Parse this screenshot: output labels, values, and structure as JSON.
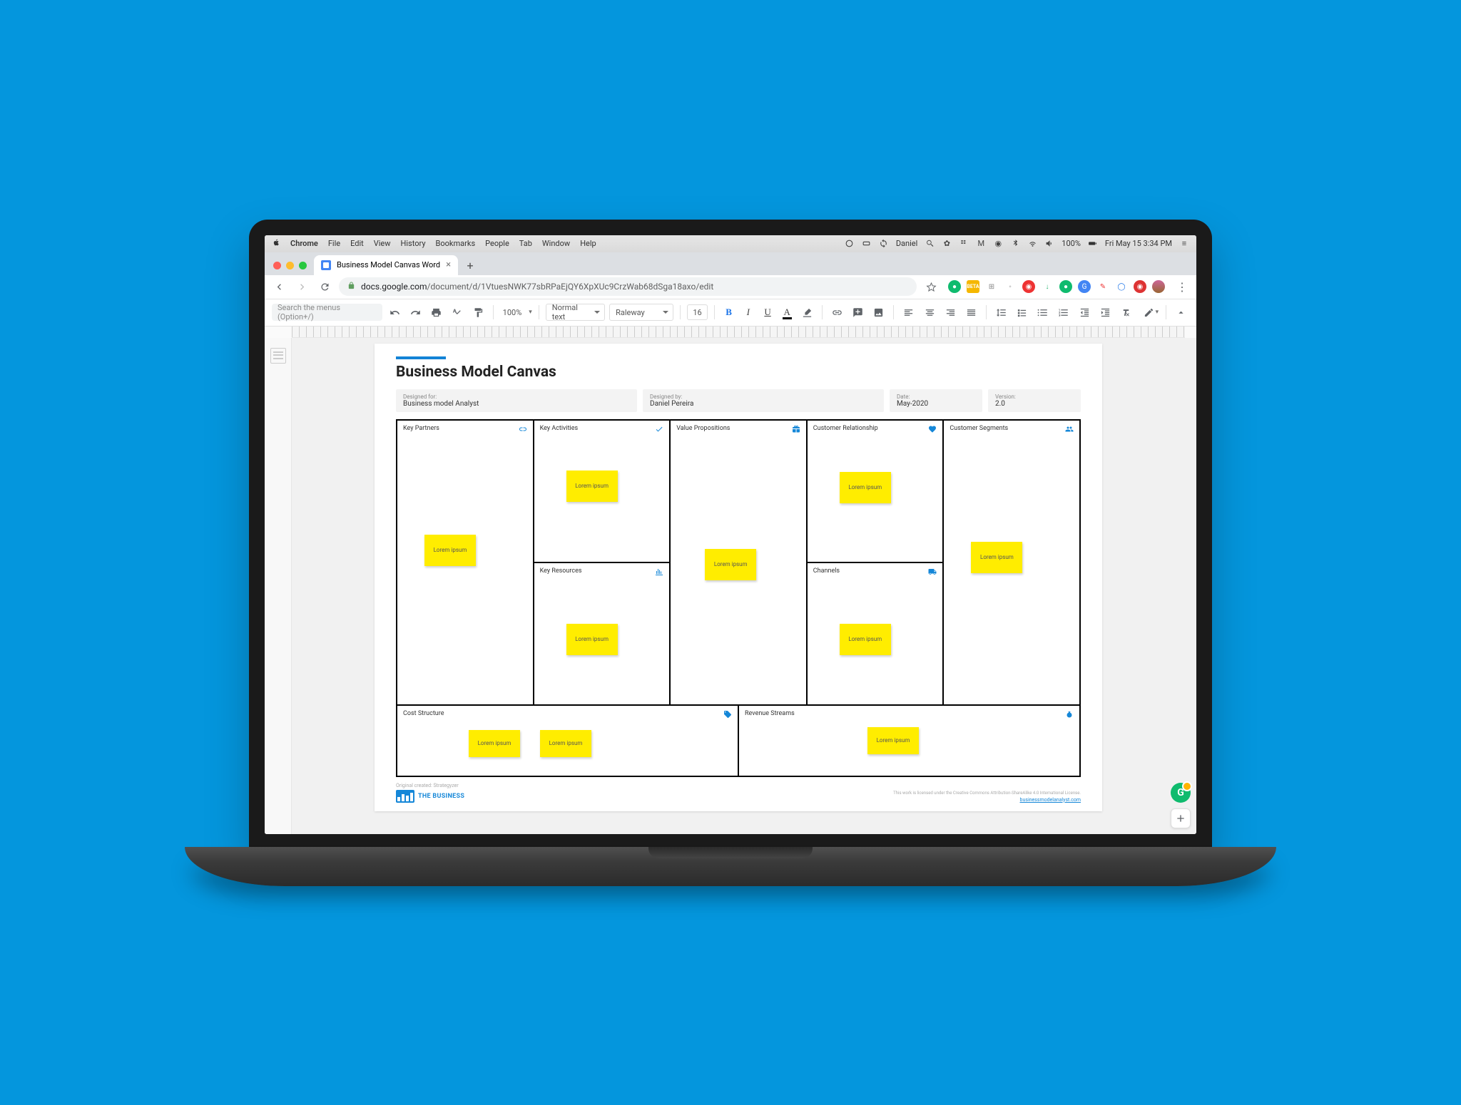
{
  "mac_menu": {
    "app": "Chrome",
    "items": [
      "File",
      "Edit",
      "View",
      "History",
      "Bookmarks",
      "People",
      "Tab",
      "Window",
      "Help"
    ],
    "user": "Daniel",
    "battery": "100%",
    "datetime": "Fri May 15  3:34 PM"
  },
  "tab": {
    "title": "Business Model Canvas Word"
  },
  "url": {
    "host": "docs.google.com",
    "path": "/document/d/1VtuesNWK77sbRPaEjQY6XpXUc9CrzWab68dSga18axo/edit"
  },
  "gd_toolbar": {
    "search_placeholder": "Search the menus (Option+/)",
    "zoom": "100%",
    "style": "Normal text",
    "font": "Raleway",
    "font_size": "16"
  },
  "doc": {
    "title": "Business Model Canvas",
    "meta": {
      "designed_for_label": "Designed for:",
      "designed_for": "Business model Analyst",
      "designed_by_label": "Designed by:",
      "designed_by": "Daniel Pereira",
      "date_label": "Date:",
      "date": "May-2020",
      "version_label": "Version:",
      "version": "2.0"
    },
    "cells": {
      "key_partners": "Key Partners",
      "key_activities": "Key Activities",
      "key_resources": "Key Resources",
      "value_propositions": "Value Propositions",
      "customer_relationship": "Customer Relationship",
      "channels": "Channels",
      "customer_segments": "Customer Segments",
      "cost_structure": "Cost Structure",
      "revenue_streams": "Revenue Streams"
    },
    "sticky": "Lorem ipsum",
    "footer": {
      "strapline": "Original created: Strategyzer",
      "brand": "THE BUSINESS",
      "license": "This work is licensed under the Creative Commons Attribution-ShareAlike 4.0 International License.",
      "link": "businessmodelanalyst.com"
    }
  }
}
